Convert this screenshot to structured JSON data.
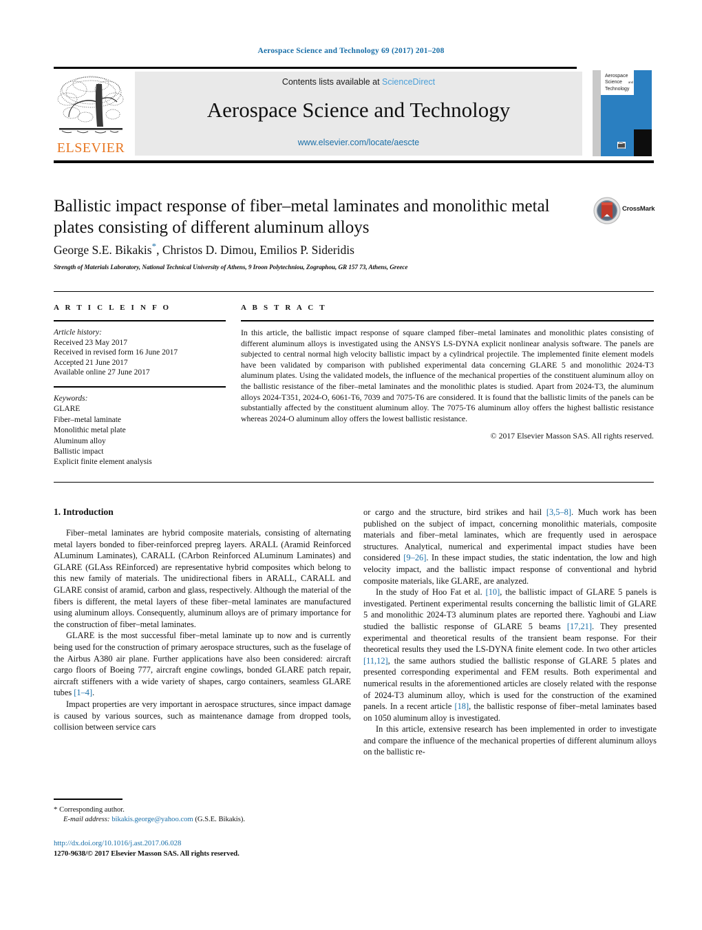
{
  "running_head": "Aerospace Science and Technology 69 (2017) 201–208",
  "masthead": {
    "contents_prefix": "Contents lists available at ",
    "contents_link": "ScienceDirect",
    "journal_name": "Aerospace Science and Technology",
    "journal_url": "www.elsevier.com/locate/aescte",
    "publisher_logo_text": "ELSEVIER",
    "cover_title_lines": [
      "Aerospace",
      "Science",
      "and",
      "Technology"
    ]
  },
  "article": {
    "title": "Ballistic impact response of fiber–metal laminates and monolithic metal plates consisting of different aluminum alloys",
    "authors": "George S.E. Bikakis",
    "authors_rest": ", Christos D. Dimou, Emilios P. Sideridis",
    "corresponding_mark": "*",
    "affiliation": "Strength of Materials Laboratory, National Technical University of Athens, 9 Iroon Polytechniou, Zographou, GR 157 73, Athens, Greece",
    "crossmark_label": "CrossMark"
  },
  "info": {
    "label": "A R T I C L E   I N F O",
    "history_header": "Article history:",
    "history": [
      "Received 23 May 2017",
      "Received in revised form 16 June 2017",
      "Accepted 21 June 2017",
      "Available online 27 June 2017"
    ],
    "keywords_header": "Keywords:",
    "keywords": [
      "GLARE",
      "Fiber–metal laminate",
      "Monolithic metal plate",
      "Aluminum alloy",
      "Ballistic impact",
      "Explicit finite element analysis"
    ]
  },
  "abstract": {
    "label": "A B S T R A C T",
    "text": "In this article, the ballistic impact response of square clamped fiber–metal laminates and monolithic plates consisting of different aluminum alloys is investigated using the ANSYS LS-DYNA explicit nonlinear analysis software. The panels are subjected to central normal high velocity ballistic impact by a cylindrical projectile. The implemented finite element models have been validated by comparison with published experimental data concerning GLARE 5 and monolithic 2024-T3 aluminum plates. Using the validated models, the influence of the mechanical properties of the constituent aluminum alloy on the ballistic resistance of the fiber–metal laminates and the monolithic plates is studied. Apart from 2024-T3, the aluminum alloys 2024-T351, 2024-O, 6061-T6, 7039 and 7075-T6 are considered. It is found that the ballistic limits of the panels can be substantially affected by the constituent aluminum alloy. The 7075-T6 aluminum alloy offers the highest ballistic resistance whereas 2024-O aluminum alloy offers the lowest ballistic resistance.",
    "copyright": "© 2017 Elsevier Masson SAS. All rights reserved."
  },
  "body": {
    "section_heading": "1. Introduction",
    "left_paragraphs": [
      "Fiber–metal laminates are hybrid composite materials, consisting of alternating metal layers bonded to fiber-reinforced prepreg layers. ARALL (Aramid Reinforced ALuminum Laminates), CARALL (CArbon Reinforced ALuminum Laminates) and GLARE (GLAss REinforced) are representative hybrid composites which belong to this new family of materials. The unidirectional fibers in ARALL, CARALL and GLARE consist of aramid, carbon and glass, respectively. Although the material of the fibers is different, the metal layers of these fiber–metal laminates are manufactured using aluminum alloys. Consequently, aluminum alloys are of primary importance for the construction of fiber–metal laminates.",
      "GLARE is the most successful fiber–metal laminate up to now and is currently being used for the construction of primary aerospace structures, such as the fuselage of the Airbus A380 air plane. Further applications have also been considered: aircraft cargo floors of Boeing 777, aircraft engine cowlings, bonded GLARE patch repair, aircraft stiffeners with a wide variety of shapes, cargo containers, seamless GLARE tubes ",
      "Impact properties are very important in aerospace structures, since impact damage is caused by various sources, such as maintenance damage from dropped tools, collision between service cars"
    ],
    "left_ref_1": "[1–4]",
    "right_paragraphs": [
      "or cargo and the structure, bird strikes and hail ",
      "In the study of Hoo Fat et al. ",
      "In this article, extensive research has been implemented in order to investigate and compare the influence of the mechanical properties of different aluminum alloys on the ballistic re-"
    ],
    "right_p1_a": "or cargo and the structure, bird strikes and hail ",
    "right_p1_ref1": "[3,5–8]",
    "right_p1_b": ". Much work has been published on the subject of impact, concerning monolithic materials, composite materials and fiber–metal laminates, which are frequently used in aerospace structures. Analytical, numerical and experimental impact studies have been considered ",
    "right_p1_ref2": "[9–26]",
    "right_p1_c": ". In these impact studies, the static indentation, the low and high velocity impact, and the ballistic impact response of conventional and hybrid composite materials, like GLARE, are analyzed.",
    "right_p2_a": "In the study of Hoo Fat et al. ",
    "right_p2_ref1": "[10]",
    "right_p2_b": ", the ballistic impact of GLARE 5 panels is investigated. Pertinent experimental results concerning the ballistic limit of GLARE 5 and monolithic 2024-T3 aluminum plates are reported there. Yaghoubi and Liaw studied the ballistic response of GLARE 5 beams ",
    "right_p2_ref2": "[17,21]",
    "right_p2_c": ". They presented experimental and theoretical results of the transient beam response. For their theoretical results they used the LS-DYNA finite element code. In two other articles ",
    "right_p2_ref3": "[11,12]",
    "right_p2_d": ", the same authors studied the ballistic response of GLARE 5 plates and presented corresponding experimental and FEM results. Both experimental and numerical results in the aforementioned articles are closely related with the response of 2024-T3 aluminum alloy, which is used for the construction of the examined panels. In a recent article ",
    "right_p2_ref4": "[18]",
    "right_p2_e": ", the ballistic response of fiber–metal laminates based on 1050 aluminum alloy is investigated."
  },
  "footnote": {
    "mark": "*",
    "corresponding": "Corresponding author.",
    "email_label": "E-mail address:",
    "email": "bikakis.george@yahoo.com",
    "email_owner": "(G.S.E. Bikakis)."
  },
  "footer": {
    "doi": "http://dx.doi.org/10.1016/j.ast.2017.06.028",
    "issn": "1270-9638/© 2017 Elsevier Masson SAS. All rights reserved."
  },
  "colors": {
    "link_blue": "#1a6fa8",
    "sciencedirect_blue": "#4a9fd8",
    "elsevier_orange": "#e87722",
    "cover_blue": "#2a7fc1"
  }
}
